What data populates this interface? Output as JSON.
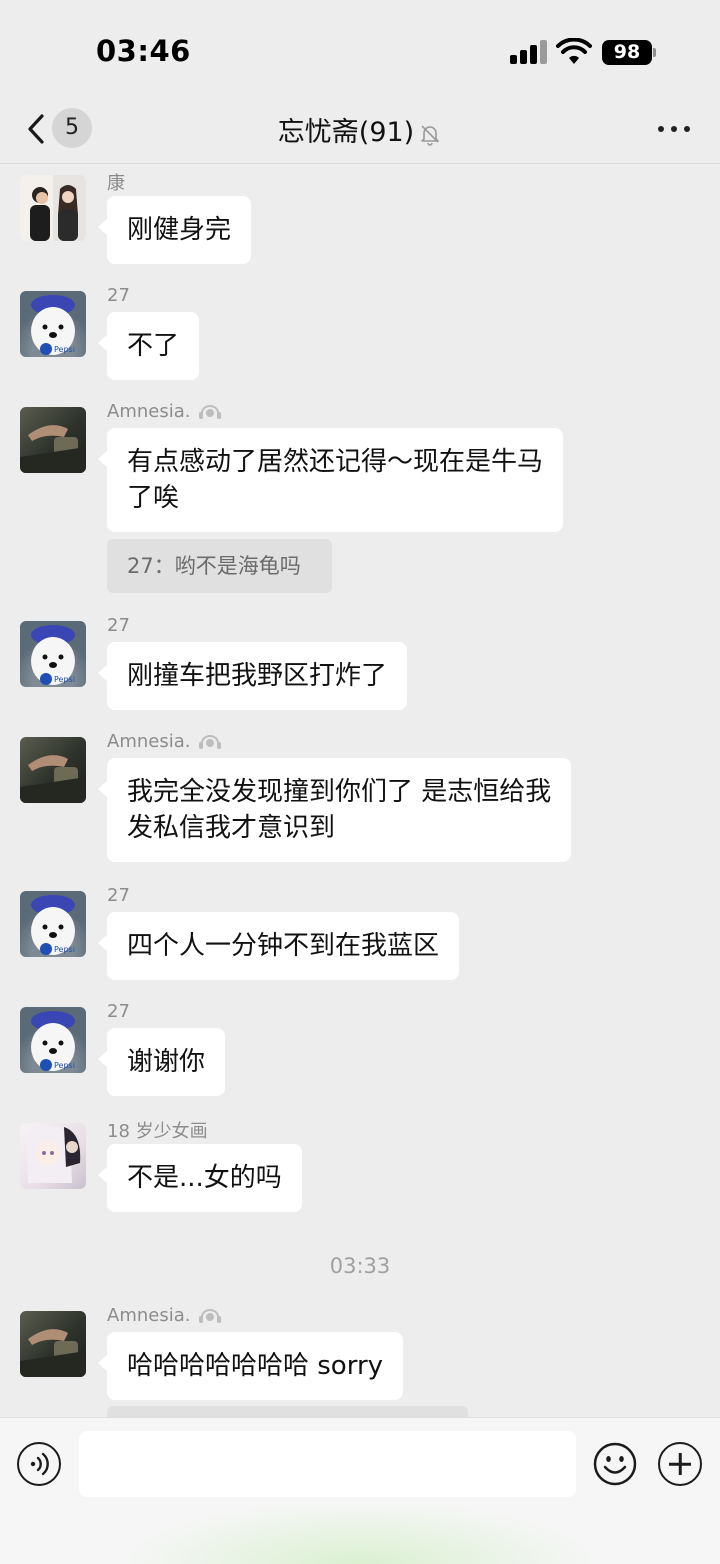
{
  "status_bar": {
    "time": "03:46",
    "battery": "98"
  },
  "nav": {
    "back_badge": "5",
    "title": "忘忧斋(91)"
  },
  "messages": [
    {
      "sender": "康",
      "avatar": "couple-photo",
      "text": "刚健身完"
    },
    {
      "sender": "27",
      "avatar": "white-dog-pepsi",
      "text": "不了"
    },
    {
      "sender": "Amnesia.",
      "avatar": "dark-hand-photo",
      "text": "有点感动了居然还记得～现在是牛马了唉",
      "text_line1": "有点感动了居然还记得～现在是牛马",
      "text_line2": "了唉",
      "quote": "27：哟不是海龟吗"
    },
    {
      "sender": "27",
      "avatar": "white-dog-pepsi",
      "text": "刚撞车把我野区打炸了"
    },
    {
      "sender": "Amnesia.",
      "avatar": "dark-hand-photo",
      "text": "我完全没发现撞到你们了 是志恒给我发私信我才意识到",
      "text_line1": "我完全没发现撞到你们了 是志恒给我",
      "text_line2": "发私信我才意识到"
    },
    {
      "sender": "27",
      "avatar": "white-dog-pepsi",
      "text": "四个人一分钟不到在我蓝区"
    },
    {
      "sender": "27",
      "avatar": "white-dog-pepsi",
      "text": "谢谢你"
    },
    {
      "sender": "18 岁少女画",
      "avatar": "anime-girl",
      "text": "不是...女的吗"
    },
    {
      "timestamp": "03:33"
    },
    {
      "sender": "Amnesia.",
      "avatar": "dark-hand-photo",
      "text": "哈哈哈哈哈哈哈 sorry"
    }
  ],
  "icons": {
    "back": "chevron-left-icon",
    "mute": "bell-slash-icon",
    "more": "ellipsis-icon",
    "earpiece": "ear-icon",
    "voice": "voice-icon",
    "emoji": "smiley-icon",
    "add": "plus-icon"
  },
  "colors": {
    "background": "#ededed",
    "bubble": "#ffffff",
    "quote": "#e0e0e0"
  }
}
